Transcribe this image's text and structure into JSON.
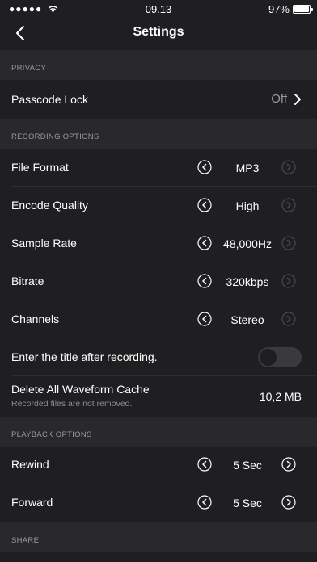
{
  "status_bar": {
    "signal": "●●●●●",
    "time": "09.13",
    "battery": "97%",
    "battery_level": 0.97
  },
  "nav": {
    "title": "Settings",
    "back_icon": "chevron-left-icon"
  },
  "sections": {
    "privacy": "PRIVACY",
    "recording": "RECORDING OPTIONS",
    "playback": "PLAYBACK OPTIONS",
    "share": "SHARE"
  },
  "privacy": {
    "passcode_label": "Passcode Lock",
    "passcode_value": "Off"
  },
  "recording": {
    "file_format": {
      "label": "File Format",
      "value": "MP3"
    },
    "encode_quality": {
      "label": "Encode Quality",
      "value": "High"
    },
    "sample_rate": {
      "label": "Sample Rate",
      "value": "48,000Hz"
    },
    "bitrate": {
      "label": "Bitrate",
      "value": "320kbps"
    },
    "channels": {
      "label": "Channels",
      "value": "Stereo"
    },
    "title_after": {
      "label": "Enter the title after recording.",
      "enabled": false
    },
    "delete_cache": {
      "label": "Delete All Waveform Cache",
      "sublabel": "Recorded files are not removed.",
      "value": "10,2 MB"
    }
  },
  "playback": {
    "rewind": {
      "label": "Rewind",
      "value": "5 Sec"
    },
    "forward": {
      "label": "Forward",
      "value": "5 Sec"
    }
  },
  "colors": {
    "background": "#1f1f21",
    "section_header": "#29292b",
    "muted_text": "#9a9a9e"
  }
}
